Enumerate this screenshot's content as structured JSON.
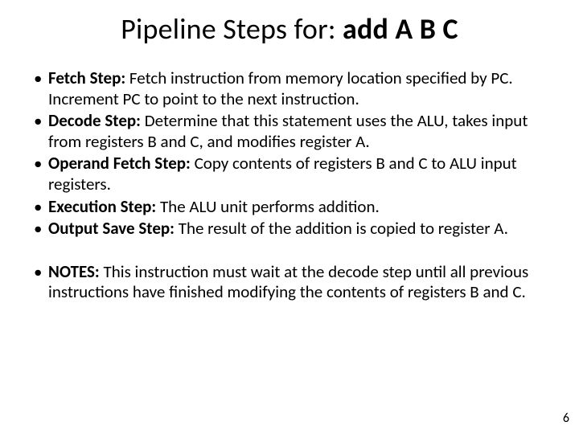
{
  "title_prefix": "Pipeline Steps for: ",
  "title_bold": "add A B C",
  "bullets_a": [
    {
      "label": "Fetch Step:",
      "text": " Fetch instruction from memory location specified by PC. Increment PC to point to the next instruction."
    },
    {
      "label": "Decode Step:",
      "text": " Determine that this statement uses the ALU, takes input from registers B and C, and modifies register A."
    },
    {
      "label": "Operand Fetch Step:",
      "text": " Copy contents of registers B and C to ALU input registers."
    },
    {
      "label": "Execution Step:",
      "text": " The ALU unit performs addition."
    },
    {
      "label": "Output Save Step:",
      "text": " The result of the addition is copied to register A."
    }
  ],
  "bullets_b": [
    {
      "label": "NOTES:",
      "text": " This instruction must wait at the decode step until all previous instructions have finished modifying the contents of registers B and C."
    }
  ],
  "page_number": "6"
}
